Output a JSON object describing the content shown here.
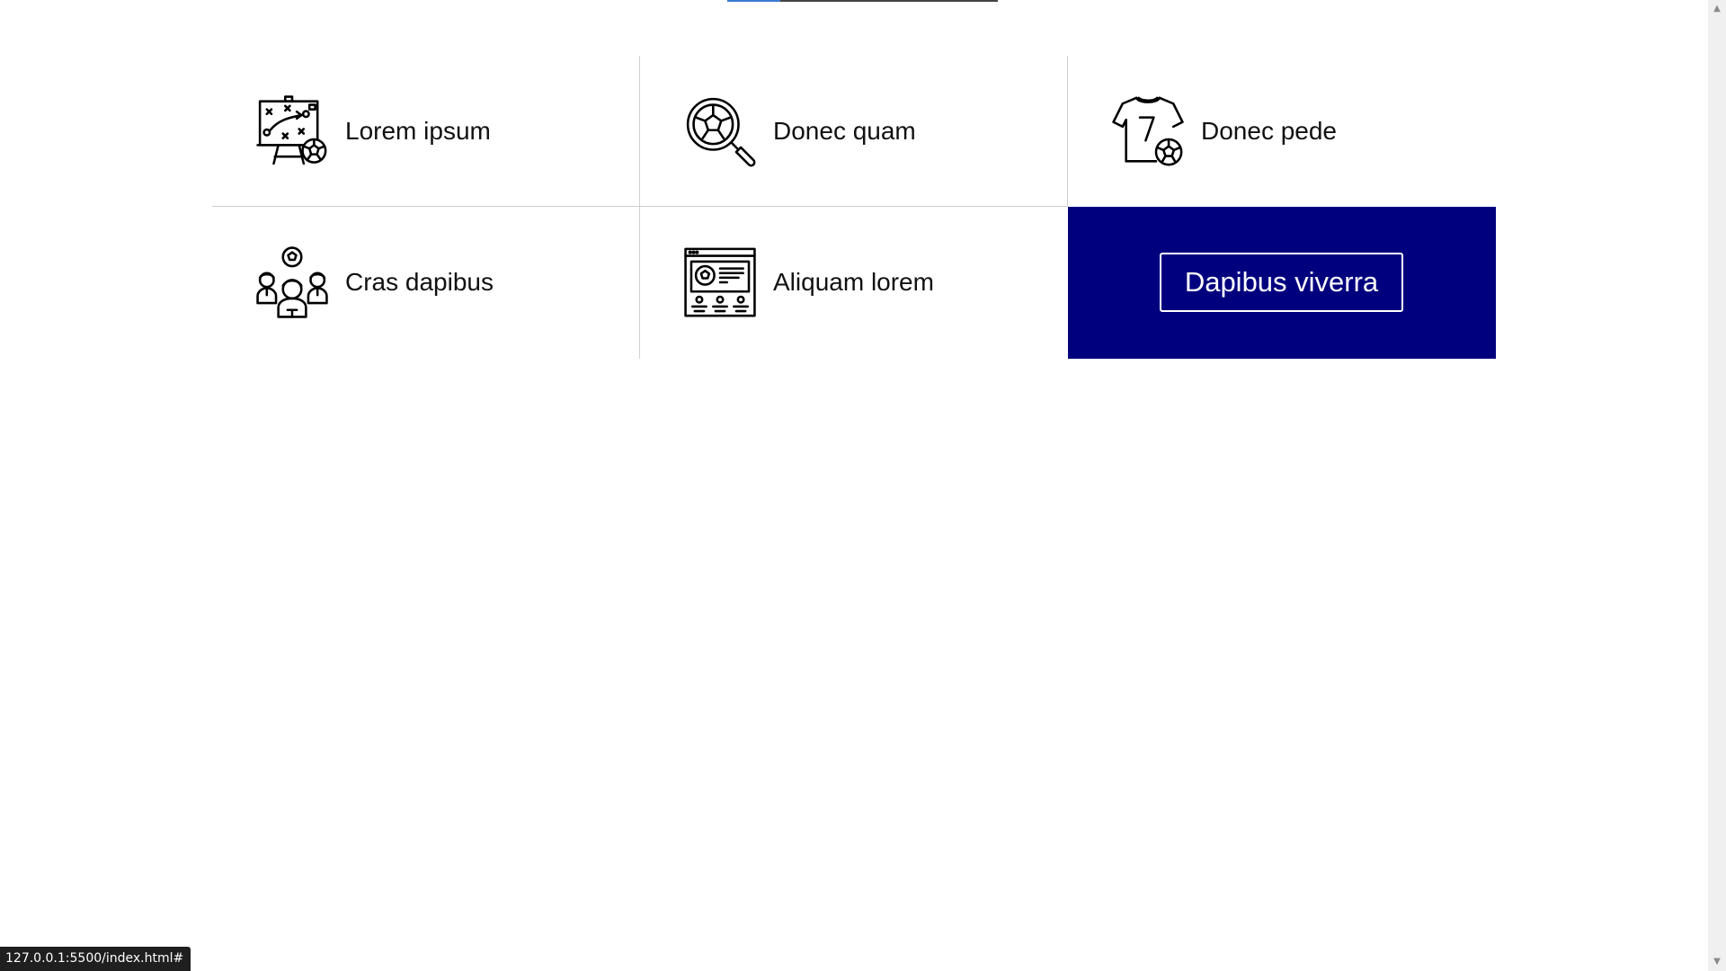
{
  "features": [
    {
      "label": "Lorem ipsum",
      "icon": "tactics-board-icon"
    },
    {
      "label": "Donec quam",
      "icon": "search-ball-icon"
    },
    {
      "label": "Donec pede",
      "icon": "jersey-icon"
    },
    {
      "label": "Cras dapibus",
      "icon": "team-icon"
    },
    {
      "label": "Aliquam lorem",
      "icon": "web-page-icon"
    }
  ],
  "cta": {
    "label": "Dapibus viverra",
    "background": "#00007f"
  },
  "status_bar": {
    "url": "127.0.0.1:5500/index.html#"
  },
  "colors": {
    "active_tab": "#3a7bd5",
    "divider": "#cfcfcf"
  }
}
